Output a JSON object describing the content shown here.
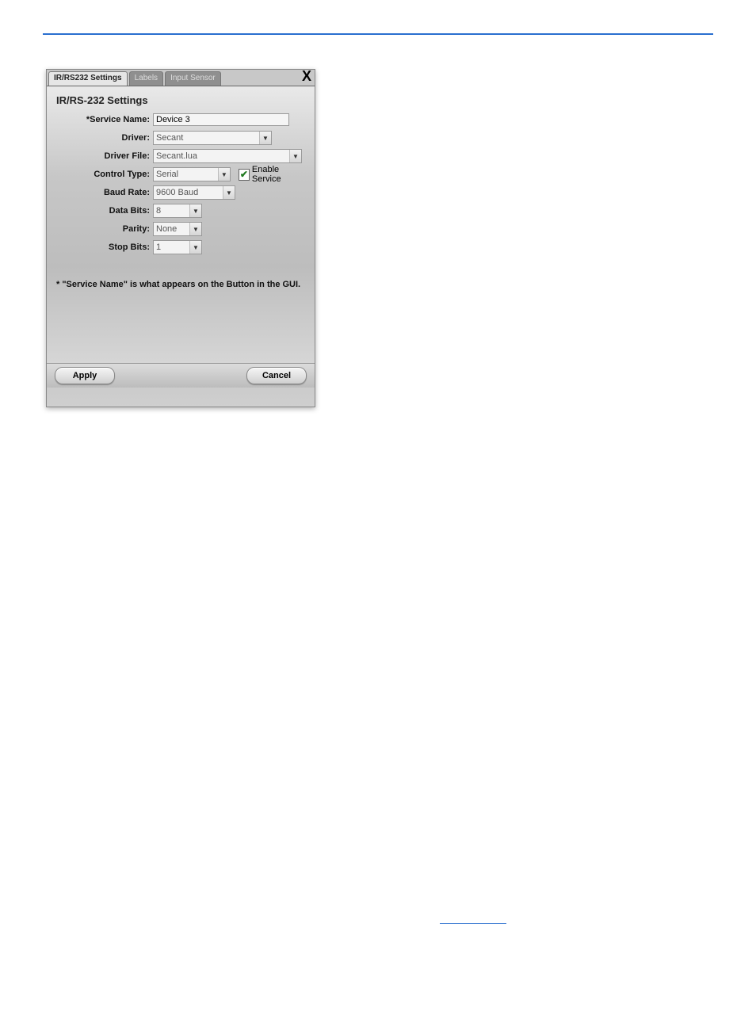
{
  "tabs": {
    "ir_rs232": "IR/RS232 Settings",
    "labels": "Labels",
    "input_sensor": "Input Sensor"
  },
  "close_label": "X",
  "panel": {
    "title": "IR/RS-232 Settings",
    "labels": {
      "service_name": "*Service Name:",
      "driver": "Driver:",
      "driver_file": "Driver File:",
      "control_type": "Control Type:",
      "baud_rate": "Baud Rate:",
      "data_bits": "Data Bits:",
      "parity": "Parity:",
      "stop_bits": "Stop Bits:"
    },
    "values": {
      "service_name": "Device 3",
      "driver": "Secant",
      "driver_file": "Secant.lua",
      "control_type": "Serial",
      "baud_rate": "9600 Baud",
      "data_bits": "8",
      "parity": "None",
      "stop_bits": "1"
    },
    "enable_service_label": "Enable Service",
    "enable_service_checked": true,
    "note": "* \"Service Name\" is what appears on the Button in the GUI."
  },
  "buttons": {
    "apply": "Apply",
    "cancel": "Cancel"
  }
}
